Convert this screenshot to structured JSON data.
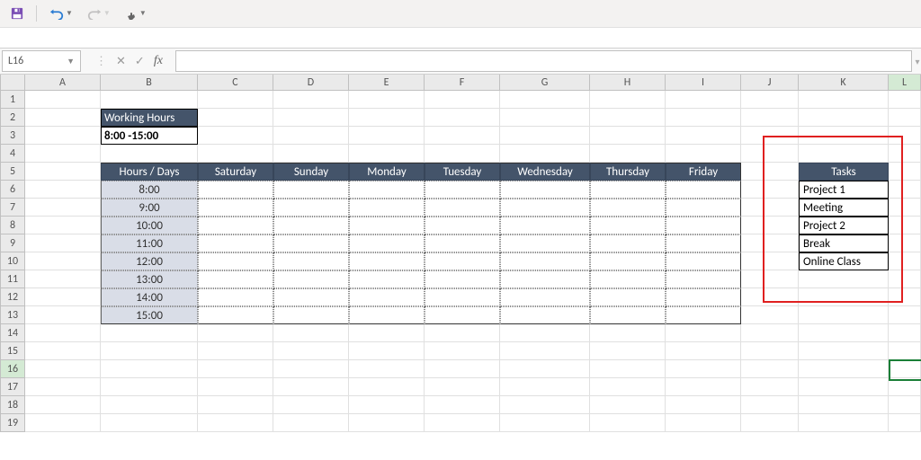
{
  "toolbar": {
    "save_icon": "save-icon",
    "undo_icon": "undo-icon",
    "redo_icon": "redo-icon",
    "touch_icon": "touch-mode-icon"
  },
  "name_box": "L16",
  "formula_value": "",
  "columns": [
    "A",
    "B",
    "C",
    "D",
    "E",
    "F",
    "G",
    "H",
    "I",
    "J",
    "K",
    "L"
  ],
  "rows": [
    1,
    2,
    3,
    4,
    5,
    6,
    7,
    8,
    9,
    10,
    11,
    12,
    13,
    14,
    15,
    16,
    17,
    18,
    19
  ],
  "content": {
    "working_hours_label": "Working Hours",
    "working_hours_value": "8:00 -15:00",
    "schedule_header": {
      "corner": "Hours / Days",
      "days": [
        "Saturday",
        "Sunday",
        "Monday",
        "Tuesday",
        "Wednesday",
        "Thursday",
        "Friday"
      ]
    },
    "hours": [
      "8:00",
      "9:00",
      "10:00",
      "11:00",
      "12:00",
      "13:00",
      "14:00",
      "15:00"
    ],
    "tasks_header": "Tasks",
    "tasks": [
      "Project 1",
      "Meeting",
      "Project 2",
      "Break",
      "Online Class"
    ]
  }
}
